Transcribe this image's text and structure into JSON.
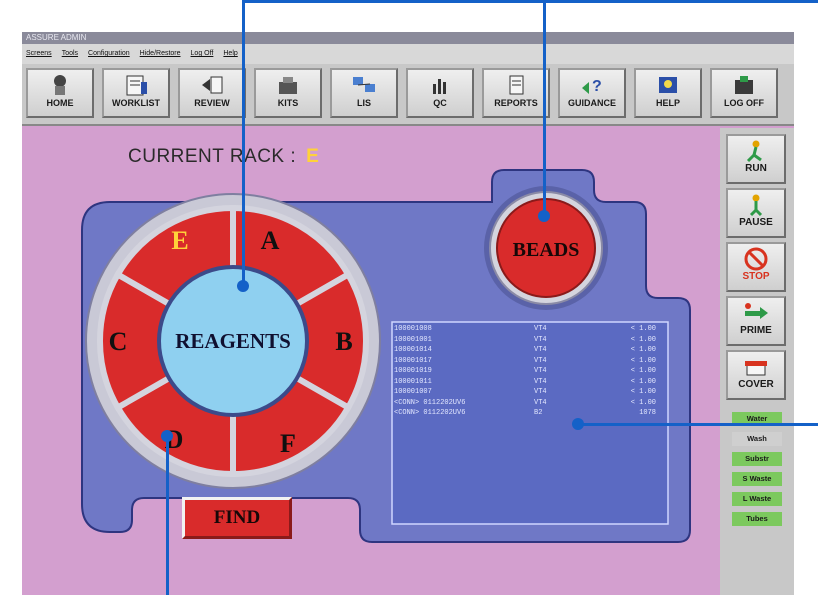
{
  "window": {
    "title": "ASSURE ADMIN"
  },
  "menu": [
    "Screens",
    "Tools",
    "Configuration",
    "Hide/Restore",
    "Log Off",
    "Help"
  ],
  "toolbar": [
    {
      "label": "HOME",
      "icon": "home-icon"
    },
    {
      "label": "WORKLIST",
      "icon": "worklist-icon"
    },
    {
      "label": "REVIEW",
      "icon": "review-icon"
    },
    {
      "label": "KITS",
      "icon": "kits-icon"
    },
    {
      "label": "LIS",
      "icon": "lis-icon"
    },
    {
      "label": "QC",
      "icon": "qc-icon"
    },
    {
      "label": "REPORTS",
      "icon": "reports-icon"
    },
    {
      "label": "GUIDANCE",
      "icon": "guidance-icon"
    },
    {
      "label": "HELP",
      "icon": "help-icon"
    },
    {
      "label": "LOG OFF",
      "icon": "logoff-icon"
    }
  ],
  "rack": {
    "label": "CURRENT RACK :",
    "value": "E"
  },
  "wheel": {
    "center_label": "REAGENTS",
    "segments": [
      "A",
      "B",
      "F",
      "D",
      "C",
      "E"
    ],
    "current": "E"
  },
  "beads_label": "BEADS",
  "find_label": "FIND",
  "log": [
    [
      "100001008",
      "VT4",
      "< 1.00"
    ],
    [
      "100001001",
      "VT4",
      "< 1.00"
    ],
    [
      "100001014",
      "VT4",
      "< 1.00"
    ],
    [
      "100001017",
      "VT4",
      "< 1.00"
    ],
    [
      "100001019",
      "VT4",
      "< 1.00"
    ],
    [
      "100001011",
      "VT4",
      "< 1.00"
    ],
    [
      "100001007",
      "VT4",
      "< 1.00"
    ],
    [
      "<CONN> 0112202UV6",
      "VT4",
      "< 1.00"
    ],
    [
      "<CONN> 0112202UV6",
      "B2",
      "1078"
    ]
  ],
  "sidebar": [
    {
      "label": "RUN",
      "icon": "run-icon"
    },
    {
      "label": "PAUSE",
      "icon": "pause-icon"
    },
    {
      "label": "STOP",
      "icon": "stop-icon"
    },
    {
      "label": "PRIME",
      "icon": "prime-icon"
    },
    {
      "label": "COVER",
      "icon": "cover-icon"
    }
  ],
  "status": [
    {
      "label": "Water",
      "state": "green"
    },
    {
      "label": "Wash",
      "state": "grey"
    },
    {
      "label": "Substr",
      "state": "green"
    },
    {
      "label": "S Waste",
      "state": "green"
    },
    {
      "label": "L Waste",
      "state": "green"
    },
    {
      "label": "Tubes",
      "state": "green"
    }
  ],
  "colors": {
    "background": "#d39fcf",
    "panel": "#6f78c6",
    "segment": "#d92b2b",
    "hub": "#8fd0f0",
    "callout": "#1461c8"
  }
}
